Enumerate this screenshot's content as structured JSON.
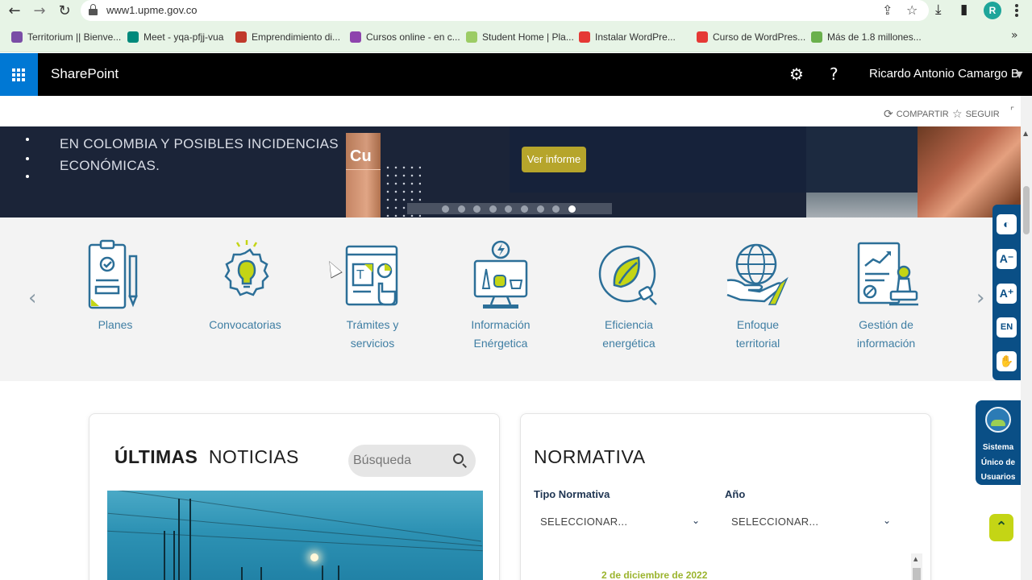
{
  "browser": {
    "url": "www1.upme.gov.co",
    "bookmarks": [
      {
        "label": "Territorium || Bienve...",
        "color": "#7a4da6"
      },
      {
        "label": "Meet - yqa-pfjj-vua",
        "color": "#00897b"
      },
      {
        "label": "Emprendimiento di...",
        "color": "#c0392b"
      },
      {
        "label": "Cursos online - en c...",
        "color": "#8e44ad"
      },
      {
        "label": "Student Home | Pla...",
        "color": "#9ccc65"
      },
      {
        "label": "Instalar WordPre...",
        "color": "#e53935"
      },
      {
        "label": "Curso de WordPres...",
        "color": "#e53935"
      },
      {
        "label": "Más de 1.8 millones...",
        "color": "#6ab04c"
      }
    ],
    "more": "»",
    "profile_initial": "R"
  },
  "suitebar": {
    "app_name": "SharePoint",
    "user_name": "Ricardo Antonio Camargo B"
  },
  "actions": {
    "share": "COMPARTIR",
    "follow": "SEGUIR"
  },
  "hero": {
    "text_line1": "EN COLOMBIA Y POSIBLES INCIDENCIAS",
    "text_line2": "ECONÓMICAS.",
    "element_symbol": "Cu",
    "cta": "Ver informe",
    "slide_count": 9,
    "active_slide": 9
  },
  "shortcuts": [
    {
      "line1": "Planes",
      "line2": "",
      "icon": "clipboard-icon"
    },
    {
      "line1": "Convocatorias",
      "line2": "",
      "icon": "lightbulb-gear-icon"
    },
    {
      "line1": "Trámites y",
      "line2": "servicios",
      "icon": "online-form-icon"
    },
    {
      "line1": "Información",
      "line2": "Enérgetica",
      "icon": "energy-info-icon"
    },
    {
      "line1": "Eficiencia",
      "line2": "energética",
      "icon": "leaf-plug-icon"
    },
    {
      "line1": "Enfoque",
      "line2": "territorial",
      "icon": "globe-hand-icon"
    },
    {
      "line1": "Gestión de",
      "line2": "información",
      "icon": "document-stamp-icon"
    }
  ],
  "a11y": {
    "contrast": "◐",
    "decrease": "A⁻",
    "increase": "A⁺",
    "language": "EN",
    "sign_language": "✋"
  },
  "sistema": {
    "line1": "Sistema",
    "line2": "Único de",
    "line3": "Usuarios"
  },
  "news": {
    "title_bold": "ÚLTIMAS",
    "title_rest": "NOTICIAS",
    "search_placeholder": "Búsqueda"
  },
  "normativa": {
    "title": "NORMATIVA",
    "tipo_label": "Tipo Normativa",
    "anio_label": "Año",
    "select_placeholder": "SELECCIONAR...",
    "first_date": "2 de diciembre de 2022"
  },
  "colors": {
    "accent_blue": "#0078d4",
    "upme_blue": "#0a4f86",
    "upme_lime": "#c4d515",
    "icon_blue": "#3f7ea3"
  }
}
